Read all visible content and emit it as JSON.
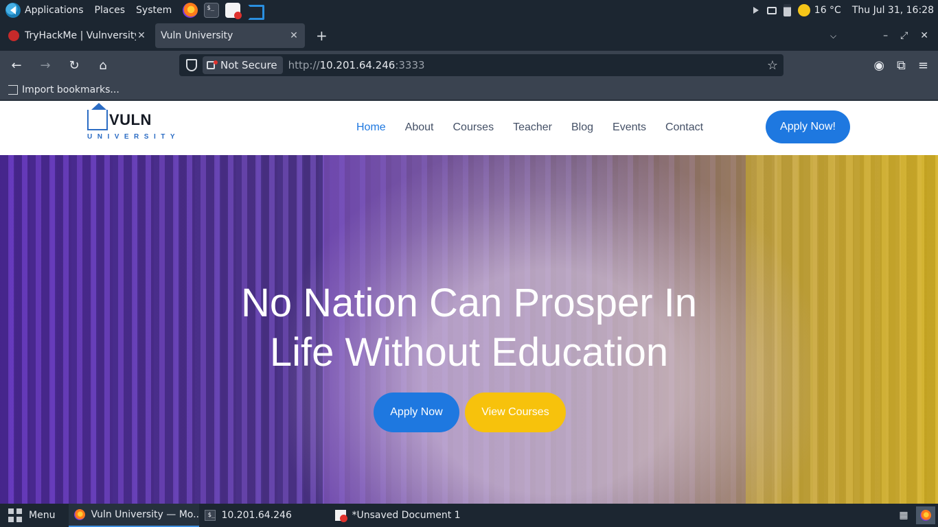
{
  "system_panel": {
    "menus": [
      "Applications",
      "Places",
      "System"
    ],
    "launchers": [
      "firefox-icon",
      "terminal-icon",
      "text-editor-icon",
      "vscode-icon"
    ],
    "temperature": "16 °C",
    "clock": "Thu Jul 31, 16:28"
  },
  "browser": {
    "tabs": [
      {
        "title": "TryHackMe | Vulnversity",
        "active": false
      },
      {
        "title": "Vuln University",
        "active": true
      }
    ],
    "url_security": "Not Secure",
    "url_scheme": "http://",
    "url_host": "10.201.64.246",
    "url_port": ":3333",
    "bookmark_item": "Import bookmarks..."
  },
  "site": {
    "brand_name": "VULN",
    "brand_sub": "UNIVERSITY",
    "nav": [
      "Home",
      "About",
      "Courses",
      "Teacher",
      "Blog",
      "Events",
      "Contact"
    ],
    "nav_active": "Home",
    "apply_top": "Apply Now!",
    "hero_line1": "No Nation Can Prosper In",
    "hero_line2": "Life Without Education",
    "hero_btn_primary": "Apply Now",
    "hero_btn_secondary": "View Courses",
    "colors": {
      "primary": "#1e78e0",
      "secondary": "#f7c20c"
    }
  },
  "taskbar": {
    "menu_label": "Menu",
    "tasks": [
      {
        "title": "Vuln University — Mo...",
        "active": true
      },
      {
        "title": "10.201.64.246",
        "active": false
      },
      {
        "title": "*Unsaved Document 1 ...",
        "active": false
      }
    ]
  }
}
